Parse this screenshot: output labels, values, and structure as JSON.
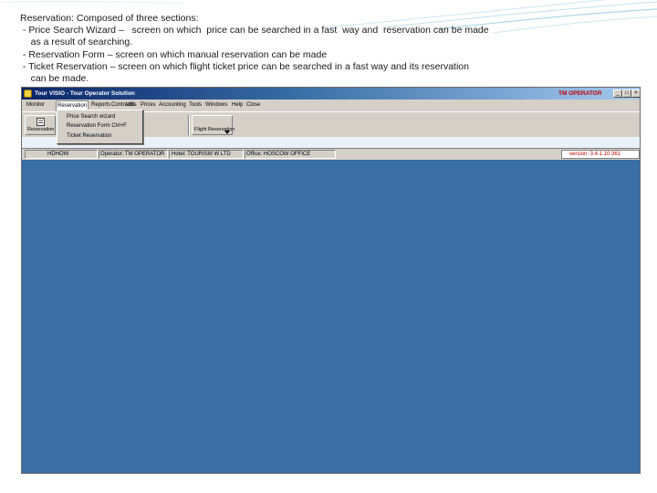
{
  "slide": {
    "lines": [
      "Reservation: Composed of three sections:",
      " - Price Search Wizard –   screen on which  price can be searched in a fast  way and  reservation can be made",
      "    as a result of searching.",
      " - Reservation Form – screen on which manual reservation can be made",
      " - Ticket Reservation – screen on which flight ticket price can be searched in a fast way and its reservation",
      "    can be made."
    ]
  },
  "app": {
    "title": "Tour VISIO - Tour Operator Solution",
    "operator_label": "TM OPERATOR",
    "window_buttons": {
      "minimize": "_",
      "maximize": "□",
      "close": "×"
    },
    "menu": [
      "Monitor",
      "Reservation",
      "Reports",
      "Contracts",
      "Utils",
      "Prices",
      "Accounting",
      "Tools",
      "Windows",
      "Help",
      "Close"
    ],
    "reservation_menu": [
      "Price Search wizard",
      "Reservation Form   Ctrl+F",
      "Ticket Reservation"
    ],
    "toolbar": {
      "left_label": "Reservation",
      "right_label": "Flight Reservation"
    },
    "status": {
      "field1": "HDHOW",
      "field2": "Operator: TM OPERATOR",
      "field3": "Hotel: TOURISM W LTD",
      "field4": "Office: HOSCOW OFFICE",
      "version": "version: 3.4.1.10.361"
    }
  },
  "colors": {
    "workspace": "#3a6ea5",
    "titlebar_start": "#0a246a",
    "operator_red": "#c00000",
    "chrome": "#d4d0c8"
  }
}
